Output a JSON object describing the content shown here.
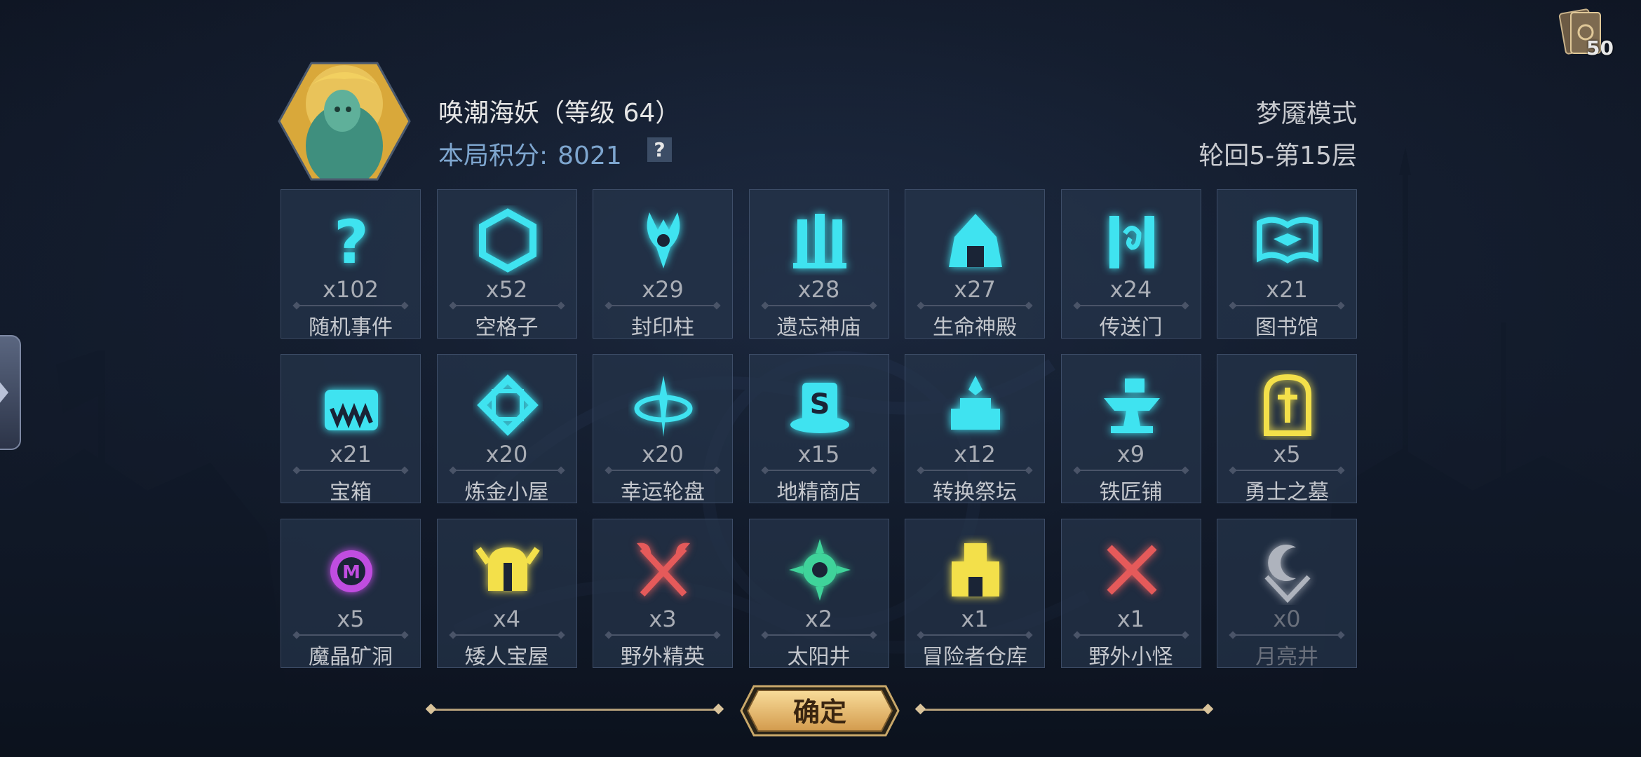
{
  "hero": {
    "name": "唤潮海妖（等级 64）",
    "score_label": "本局积分:",
    "score_value": "8021",
    "help_label": "?"
  },
  "mode": "梦魇模式",
  "floor": "轮回5-第15层",
  "deck_count": "50",
  "confirm_label": "确定",
  "tiles": [
    {
      "count": "x102",
      "name": "随机事件",
      "icon": "question-icon",
      "color": "#3fe3f0"
    },
    {
      "count": "x52",
      "name": "空格子",
      "icon": "hexagon-icon",
      "color": "#3fe3f0"
    },
    {
      "count": "x29",
      "name": "封印柱",
      "icon": "seal-pillar-icon",
      "color": "#3fe3f0"
    },
    {
      "count": "x28",
      "name": "遗忘神庙",
      "icon": "temple-icon",
      "color": "#3fe3f0"
    },
    {
      "count": "x27",
      "name": "生命神殿",
      "icon": "life-shrine-icon",
      "color": "#3fe3f0"
    },
    {
      "count": "x24",
      "name": "传送门",
      "icon": "portal-icon",
      "color": "#3fe3f0"
    },
    {
      "count": "x21",
      "name": "图书馆",
      "icon": "book-icon",
      "color": "#3fe3f0"
    },
    {
      "count": "x21",
      "name": "宝箱",
      "icon": "chest-icon",
      "color": "#3fe3f0"
    },
    {
      "count": "x20",
      "name": "炼金小屋",
      "icon": "alchemy-icon",
      "color": "#3fe3f0"
    },
    {
      "count": "x20",
      "name": "幸运轮盘",
      "icon": "wheel-icon",
      "color": "#3fe3f0"
    },
    {
      "count": "x15",
      "name": "地精商店",
      "icon": "goblin-shop-icon",
      "color": "#3fe3f0"
    },
    {
      "count": "x12",
      "name": "转换祭坛",
      "icon": "altar-icon",
      "color": "#3fe3f0"
    },
    {
      "count": "x9",
      "name": "铁匠铺",
      "icon": "anvil-icon",
      "color": "#3fe3f0"
    },
    {
      "count": "x5",
      "name": "勇士之墓",
      "icon": "tomb-icon",
      "color": "#f3e04a"
    },
    {
      "count": "x5",
      "name": "魔晶矿洞",
      "icon": "crystal-mine-icon",
      "color": "#c04de0"
    },
    {
      "count": "x4",
      "name": "矮人宝屋",
      "icon": "dwarf-helmet-icon",
      "color": "#f3e04a"
    },
    {
      "count": "x3",
      "name": "野外精英",
      "icon": "crossed-axes-icon",
      "color": "#e55a5a"
    },
    {
      "count": "x2",
      "name": "太阳井",
      "icon": "sun-well-icon",
      "color": "#3fd39a"
    },
    {
      "count": "x1",
      "name": "冒险者仓库",
      "icon": "warehouse-icon",
      "color": "#f3e04a"
    },
    {
      "count": "x1",
      "name": "野外小怪",
      "icon": "crossed-swords-icon",
      "color": "#e55a5a"
    },
    {
      "count": "x0",
      "name": "月亮井",
      "icon": "moon-well-icon",
      "color": "#c8ccd4",
      "dim": true
    }
  ]
}
